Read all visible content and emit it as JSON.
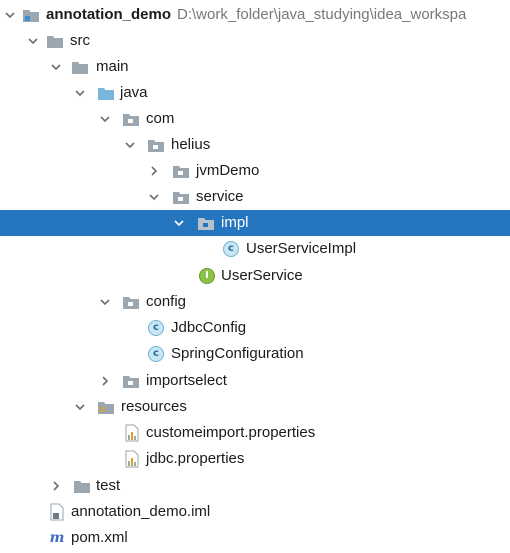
{
  "tree": {
    "root": {
      "name": "annotation_demo",
      "path": "D:\\work_folder\\java_studying\\idea_workspa"
    },
    "nodes": {
      "src": "src",
      "main": "main",
      "java": "java",
      "com": "com",
      "helius": "helius",
      "jvmDemo": "jvmDemo",
      "service": "service",
      "impl": "impl",
      "UserServiceImpl": "UserServiceImpl",
      "UserService": "UserService",
      "config": "config",
      "JdbcConfig": "JdbcConfig",
      "SpringConfiguration": "SpringConfiguration",
      "importselect": "importselect",
      "resources": "resources",
      "customeimport": "customeimport.properties",
      "jdbc": "jdbc.properties",
      "test": "test",
      "iml": "annotation_demo.iml",
      "pom": "pom.xml"
    },
    "selected": "impl",
    "colors": {
      "selection": "#2675bf",
      "folder": "#9aa7b0",
      "source_folder": "#7ab6db",
      "class_badge": "#c8e6f3",
      "interface_badge": "#8bc34a"
    }
  }
}
